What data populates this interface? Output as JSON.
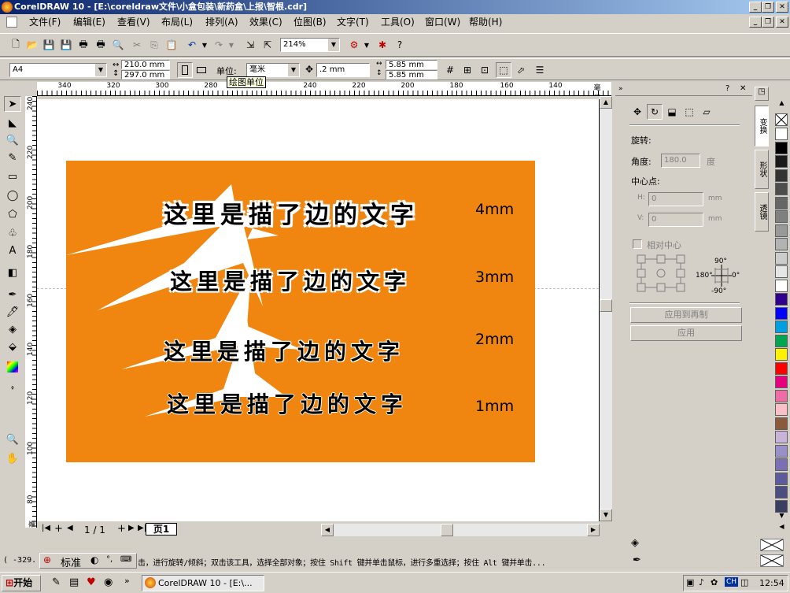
{
  "window": {
    "title": "CorelDRAW 10 - [E:\\coreldraw文件\\小盒包装\\新药盒\\上报\\智根.cdr]"
  },
  "menu": [
    "文件(F)",
    "编辑(E)",
    "查看(V)",
    "布局(L)",
    "排列(A)",
    "效果(C)",
    "位图(B)",
    "文字(T)",
    "工具(O)",
    "窗口(W)",
    "帮助(H)"
  ],
  "toolbar": {
    "zoom": "214%"
  },
  "propbar": {
    "page_size": "A4",
    "width": "210.0 mm",
    "height": "297.0 mm",
    "unit_label": "单位:",
    "unit_value": "毫米",
    "nudge": ".2 mm",
    "dup_x": "5.85 mm",
    "dup_y": "5.85 mm",
    "tooltip": "绘图单位"
  },
  "ruler": {
    "h_ticks": [
      "340",
      "320",
      "300",
      "280",
      "260",
      "240",
      "220",
      "200",
      "180",
      "160",
      "140"
    ],
    "h_unit": "毫米",
    "v_ticks": [
      "240",
      "220",
      "200",
      "180",
      "160",
      "140",
      "120",
      "100",
      "80"
    ],
    "v_unit": "毫米"
  },
  "canvas": {
    "rows": [
      {
        "text": "这里是描了边的文字",
        "label": "4mm"
      },
      {
        "text": "这里是描了边的文字",
        "label": "3mm"
      },
      {
        "text": "这里是描了边的文字",
        "label": "2mm"
      },
      {
        "text": "这里是描了边的文字",
        "label": "1mm"
      }
    ],
    "bg_color": "#f08610"
  },
  "page_nav": {
    "current": "1 / 1",
    "tab": "页1"
  },
  "docker": {
    "rotate_label": "旋转:",
    "angle_label": "角度:",
    "angle_value": "180.0",
    "angle_unit": "度",
    "center_label": "中心点:",
    "h_label": "H:",
    "h_value": "0",
    "v_label": "V:",
    "v_value": "0",
    "mm1": "mm",
    "mm2": "mm",
    "relative_center": "相对中心",
    "deg_90": "90°",
    "deg_180": "180°",
    "deg_0": "0°",
    "deg_m90": "-90°",
    "apply_dup": "应用到再制",
    "apply": "应用",
    "side_tabs": [
      "变换",
      "形状",
      "透镜"
    ]
  },
  "palette_colors": [
    "#ffffff",
    "#000000",
    "#1a1a1a",
    "#333333",
    "#4d4d4d",
    "#666666",
    "#808080",
    "#999999",
    "#b3b3b3",
    "#cccccc",
    "#e6e6e6",
    "#ffffff",
    "#2e008b",
    "#0000ff",
    "#00a0e0",
    "#00a651",
    "#fff200",
    "#ff0000",
    "#e6007e",
    "#ec6ea4",
    "#f9c0c8",
    "#8b5a3c",
    "#c8b4d8",
    "#9b8fc7",
    "#7c70b4",
    "#5e5a9e",
    "#4a4e80",
    "#3a3e60"
  ],
  "status": {
    "coords": "( -329.",
    "hint": "击，进行旋转/倾斜；双击该工具，选择全部对象；按住 Shift 键并单击鼠标，进行多重选择；按住 Alt 键并单击...",
    "ime_mode": "标准"
  },
  "taskbar": {
    "start": "开始",
    "task": "CorelDRAW 10 - [E:\\...",
    "lang": "CH",
    "clock": "12:54"
  }
}
